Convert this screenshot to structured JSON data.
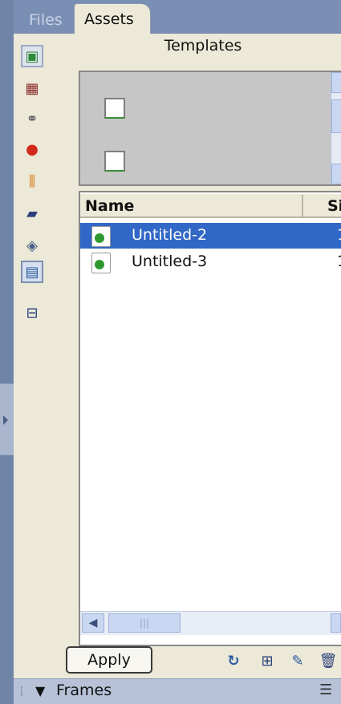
{
  "tabs": [
    {
      "label": "Files",
      "active": false
    },
    {
      "label": "Assets",
      "active": true
    }
  ],
  "category_icons": [
    {
      "name": "images-icon",
      "glyph": "▣",
      "color": "#2f8a3a"
    },
    {
      "name": "colors-icon",
      "glyph": "▦",
      "color": "#8a2a2a"
    },
    {
      "name": "urls-icon",
      "glyph": "⚭",
      "color": "#555555"
    },
    {
      "name": "flash-icon",
      "glyph": "●",
      "color": "#d22a1a"
    },
    {
      "name": "shockwave-icon",
      "glyph": "⫼",
      "color": "#d07a10"
    },
    {
      "name": "movies-icon",
      "glyph": "▰",
      "color": "#2a3f7a"
    },
    {
      "name": "scripts-icon",
      "glyph": "◈",
      "color": "#4a5f85"
    },
    {
      "name": "templates-icon",
      "glyph": "▤",
      "color": "#2a5aa0"
    },
    {
      "name": "library-icon",
      "glyph": "⊟",
      "color": "#2a3f7a"
    }
  ],
  "panel": {
    "title": "Templates"
  },
  "table": {
    "columns": [
      "Name",
      "Si"
    ],
    "rows": [
      {
        "name": "Untitled-2",
        "size": "1",
        "selected": true
      },
      {
        "name": "Untitled-3",
        "size": "1",
        "selected": false
      }
    ]
  },
  "scrollbar": {
    "thumb_grip": "|||"
  },
  "buttons": {
    "apply": "Apply"
  },
  "toolbar_icons": [
    {
      "name": "refresh-icon",
      "glyph": "↻",
      "color": "#2a5aa0"
    },
    {
      "name": "new-template-icon",
      "glyph": "⊞",
      "color": "#2a3f7a"
    },
    {
      "name": "edit-icon",
      "glyph": "✎",
      "color": "#2a5aa0"
    },
    {
      "name": "delete-icon",
      "glyph": "🗑",
      "color": "#2a3f7a"
    }
  ],
  "frames_panel": {
    "label": "Frames",
    "grip": "⁞",
    "menu_glyph": "☰"
  }
}
